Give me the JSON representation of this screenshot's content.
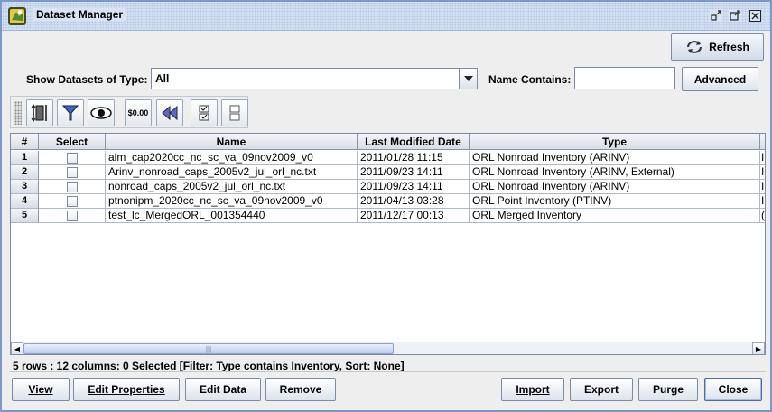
{
  "window": {
    "title": "Dataset Manager"
  },
  "header": {
    "refresh_label": "Refresh"
  },
  "filter": {
    "type_label": "Show Datasets of Type:",
    "type_value": "All",
    "name_label": "Name Contains:",
    "name_value": "",
    "advanced_label": "Advanced"
  },
  "toolbar": {
    "buttons": [
      {
        "icon": "column-resize-icon"
      },
      {
        "icon": "filter-icon"
      },
      {
        "icon": "view-eye-icon"
      },
      {
        "icon": "format-numbers-icon",
        "text": "$0.00"
      },
      {
        "icon": "reset-rewind-icon"
      },
      {
        "icon": "select-all-icon"
      },
      {
        "icon": "clear-selection-icon"
      }
    ]
  },
  "table": {
    "columns": [
      "#",
      "Select",
      "Name",
      "Last Modified Date",
      "Type"
    ],
    "rows": [
      {
        "num": "1",
        "name": "alm_cap2020cc_nc_sc_va_09nov2009_v0",
        "date": "2011/01/28 11:15",
        "type": "ORL Nonroad Inventory (ARINV)",
        "extra": "I"
      },
      {
        "num": "2",
        "name": "Arinv_nonroad_caps_2005v2_jul_orl_nc.txt",
        "date": "2011/09/23 14:11",
        "type": "ORL Nonroad Inventory (ARINV, External)",
        "extra": "I"
      },
      {
        "num": "3",
        "name": "nonroad_caps_2005v2_jul_orl_nc.txt",
        "date": "2011/09/23 14:11",
        "type": "ORL Nonroad Inventory (ARINV)",
        "extra": "I"
      },
      {
        "num": "4",
        "name": "ptnonipm_2020cc_nc_sc_va_09nov2009_v0",
        "date": "2011/04/13 03:28",
        "type": "ORL Point Inventory (PTINV)",
        "extra": "I"
      },
      {
        "num": "5",
        "name": "test_lc_MergedORL_001354440",
        "date": "2011/12/17 00:13",
        "type": "ORL Merged Inventory",
        "extra": "("
      }
    ]
  },
  "status": {
    "text": "5 rows : 12 columns: 0 Selected [Filter: Type contains Inventory, Sort: None]"
  },
  "footer": {
    "view": "View",
    "edit_properties": "Edit Properties",
    "edit_data": "Edit Data",
    "remove": "Remove",
    "import": "Import",
    "export": "Export",
    "purge": "Purge",
    "close": "Close"
  }
}
